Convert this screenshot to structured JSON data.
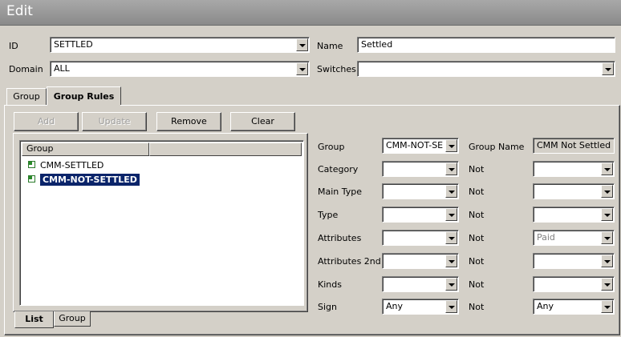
{
  "window": {
    "title": "Edit"
  },
  "header": {
    "id_label": "ID",
    "id_value": "SETTLED",
    "name_label": "Name",
    "name_value": "Settled",
    "domain_label": "Domain",
    "domain_value": "ALL",
    "switches_label": "Switches",
    "switches_value": ""
  },
  "tabs": [
    {
      "label": "Group",
      "active": false
    },
    {
      "label": "Group Rules",
      "active": true
    }
  ],
  "toolbar": {
    "add": "Add",
    "update": "Update",
    "remove": "Remove",
    "clear": "Clear"
  },
  "list": {
    "column": "Group",
    "items": [
      {
        "label": "CMM-SETTLED",
        "selected": false,
        "icon": "group-node-icon"
      },
      {
        "label": "CMM-NOT-SETTLED",
        "selected": true,
        "icon": "group-node-icon"
      }
    ]
  },
  "bottom_tabs": [
    {
      "label": "List",
      "active": true
    },
    {
      "label": "Group",
      "active": false
    }
  ],
  "form": {
    "group_label": "Group",
    "group_value": "CMM-NOT-SE",
    "group_name_label": "Group Name",
    "group_name_value": "CMM Not Settled",
    "rows": [
      {
        "label": "Category",
        "value": "",
        "not_label": "Not",
        "not_value": ""
      },
      {
        "label": "Main Type",
        "value": "",
        "not_label": "Not",
        "not_value": ""
      },
      {
        "label": "Type",
        "value": "",
        "not_label": "Not",
        "not_value": ""
      },
      {
        "label": "Attributes",
        "value": "",
        "not_label": "Not",
        "not_value": "Paid"
      },
      {
        "label": "Attributes 2nd",
        "value": "",
        "not_label": "Not",
        "not_value": ""
      },
      {
        "label": "Kinds",
        "value": "",
        "not_label": "Not",
        "not_value": ""
      },
      {
        "label": "Sign",
        "value": "Any",
        "not_label": "Not",
        "not_value": "Any"
      }
    ]
  }
}
